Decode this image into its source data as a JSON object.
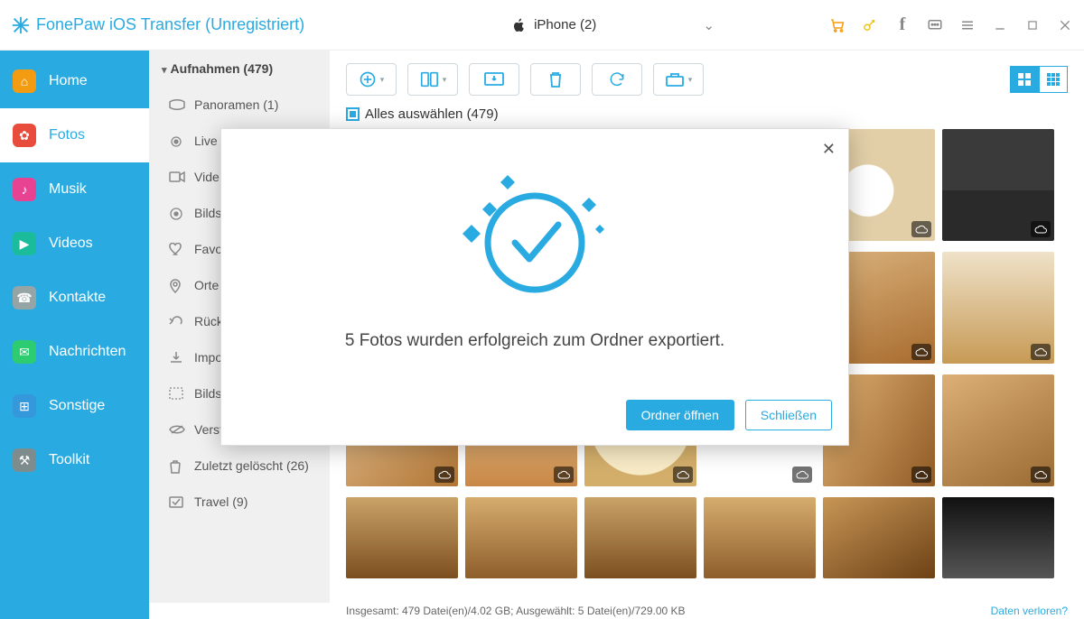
{
  "title": "FonePaw iOS Transfer (Unregistriert)",
  "device": "iPhone (2)",
  "nav": {
    "home": "Home",
    "fotos": "Fotos",
    "musik": "Musik",
    "videos": "Videos",
    "kontakte": "Kontakte",
    "nachrichten": "Nachrichten",
    "sonstige": "Sonstige",
    "toolkit": "Toolkit"
  },
  "sublist": {
    "header": "Aufnahmen (479)",
    "items": [
      "Panoramen (1)",
      "Live",
      "Vide",
      "Bilds",
      "Favo",
      "Orte",
      "Rück",
      "Impo",
      "Bilds",
      "Versteckt (7)",
      "Zuletzt gelöscht (26)",
      "Travel (9)"
    ]
  },
  "select_all": "Alles auswählen (479)",
  "status": "Insgesamt: 479 Datei(en)/4.02 GB; Ausgewählt: 5 Datei(en)/729.00 KB",
  "lost": "Daten verloren?",
  "modal": {
    "message": "5 Fotos wurden erfolgreich zum Ordner exportiert.",
    "open": "Ordner öffnen",
    "close": "Schließen"
  }
}
